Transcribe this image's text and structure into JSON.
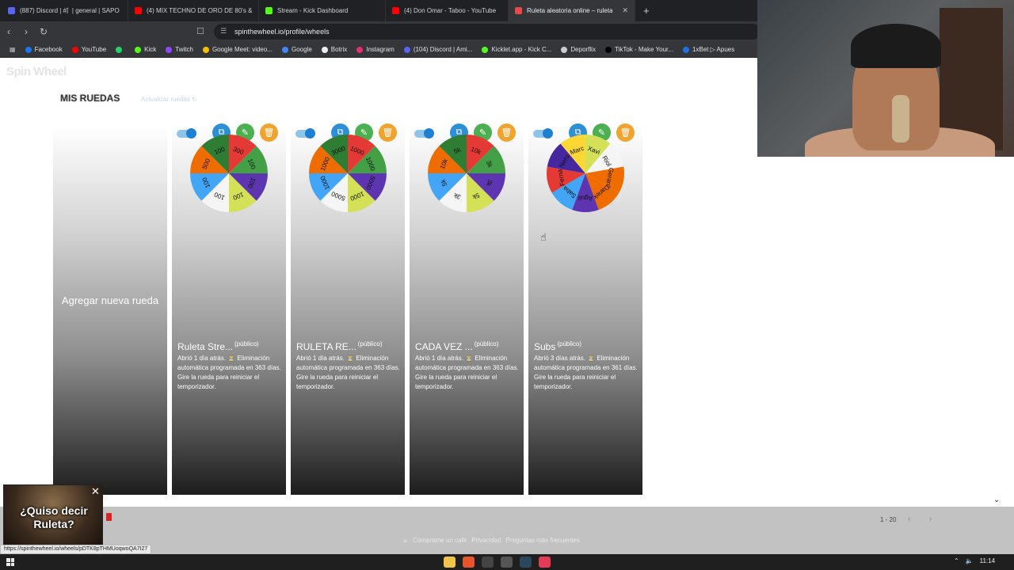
{
  "browser": {
    "tabs": [
      {
        "label": "(887) Discord | #⌈  | general | SAPO",
        "color": "#5865f2",
        "active": false
      },
      {
        "label": "(4) MIX TECHNO DE ORO DE 80's &",
        "color": "#ff0000",
        "active": false
      },
      {
        "label": "Stream - Kick Dashboard",
        "color": "#53fc18",
        "active": false
      },
      {
        "label": "(4) Don Omar - Taboo - YouTube",
        "color": "#ff0000",
        "active": false
      },
      {
        "label": "Ruleta aleatoria online – ruleta d",
        "color": "#e84a4a",
        "active": true
      }
    ],
    "new_tab": "+",
    "url": "spinthewheel.io/profile/wheels",
    "bookmarks": [
      {
        "label": "Facebook",
        "color": "#1877f2"
      },
      {
        "label": "YouTube",
        "color": "#ff0000"
      },
      {
        "label": "",
        "color": "#25d366"
      },
      {
        "label": "Kick",
        "color": "#53fc18"
      },
      {
        "label": "Twitch",
        "color": "#9146ff"
      },
      {
        "label": "Google Meet: video...",
        "color": "#fbbc04"
      },
      {
        "label": "Google",
        "color": "#4285f4"
      },
      {
        "label": "Botrix",
        "color": "#eeeeee"
      },
      {
        "label": "Instagram",
        "color": "#e1306c"
      },
      {
        "label": "(104) Discord | Ami...",
        "color": "#5865f2"
      },
      {
        "label": "Kicklet.app - Kick C...",
        "color": "#53fc18"
      },
      {
        "label": "Deporflix",
        "color": "#cccccc"
      },
      {
        "label": "TikTok - Make Your...",
        "color": "#000000"
      },
      {
        "label": "1xBet ▷ Apues",
        "color": "#1a73e8"
      }
    ]
  },
  "page": {
    "logo": "Spin Wheel",
    "section_title": "MIS RUEDAS",
    "refresh_label": "Actualizar ruedas",
    "add_wheel_label": "Agregar nueva rueda",
    "public_badge": "(público)",
    "wheels": [
      {
        "name": "Ruleta Stre...",
        "description": "Abrió 1 día atrás. ⏳ Eliminación automática programada en 363 días. Gire la rueda para reiniciar el temporizador.",
        "segments": [
          "300",
          "100",
          "100",
          "100",
          "100",
          "100",
          "500",
          "100"
        ],
        "colors": [
          "#e53935",
          "#43a047",
          "#5e35b1",
          "#d4e157",
          "#f5f5f5",
          "#42a5f5",
          "#ef6c00",
          "#2e7d32"
        ]
      },
      {
        "name": "RULETA RE...",
        "description": "Abrió 1 día atrás. ⏳ Eliminación automática programada en 363 días. Gire la rueda para reiniciar el temporizador.",
        "segments": [
          "1000",
          "1000",
          "5000",
          "1000",
          "5000",
          "1000",
          "1000",
          "3000"
        ],
        "colors": [
          "#e53935",
          "#43a047",
          "#5e35b1",
          "#d4e157",
          "#f5f5f5",
          "#42a5f5",
          "#ef6c00",
          "#2e7d32"
        ]
      },
      {
        "name": "CADA VEZ ...",
        "description": "Abrió 1 día atrás. ⏳ Eliminación automática programada en 363 días. Gire la rueda para reiniciar el temporizador.",
        "segments": [
          "10k",
          "3k",
          "3k",
          "5k",
          "3k",
          "5k",
          "10k",
          "5k"
        ],
        "colors": [
          "#e53935",
          "#43a047",
          "#5e35b1",
          "#d4e157",
          "#f5f5f5",
          "#42a5f5",
          "#ef6c00",
          "#2e7d32"
        ]
      },
      {
        "name": "Subs",
        "description": "Abrió 3 días atrás. ⏳ Eliminación automática programada en 361 días. Gire la rueda para reiniciar el temporizador.",
        "segments": [
          "Xavi",
          "Riol",
          "Gerard",
          "Dariek",
          "Aguil",
          "Saba",
          "Ferna",
          "Nero",
          "Marc"
        ],
        "colors": [
          "#d4e157",
          "#f5f5f5",
          "#ef6c00",
          "#ef6c00",
          "#5e35b1",
          "#42a5f5",
          "#e53935",
          "#4527a0",
          "#fdd835"
        ]
      }
    ],
    "pager": "1 - 20",
    "footer_links": [
      "Cómprame un café",
      "Privacidad",
      "Preguntas más frecuentes"
    ],
    "promo_text": "¿Quiso decir Ruleta?",
    "status_url": "https://spinthewheel.io/wheels/pDTK8pTHMUoqwoQA7I27"
  },
  "taskbar": {
    "time": "11:14"
  }
}
